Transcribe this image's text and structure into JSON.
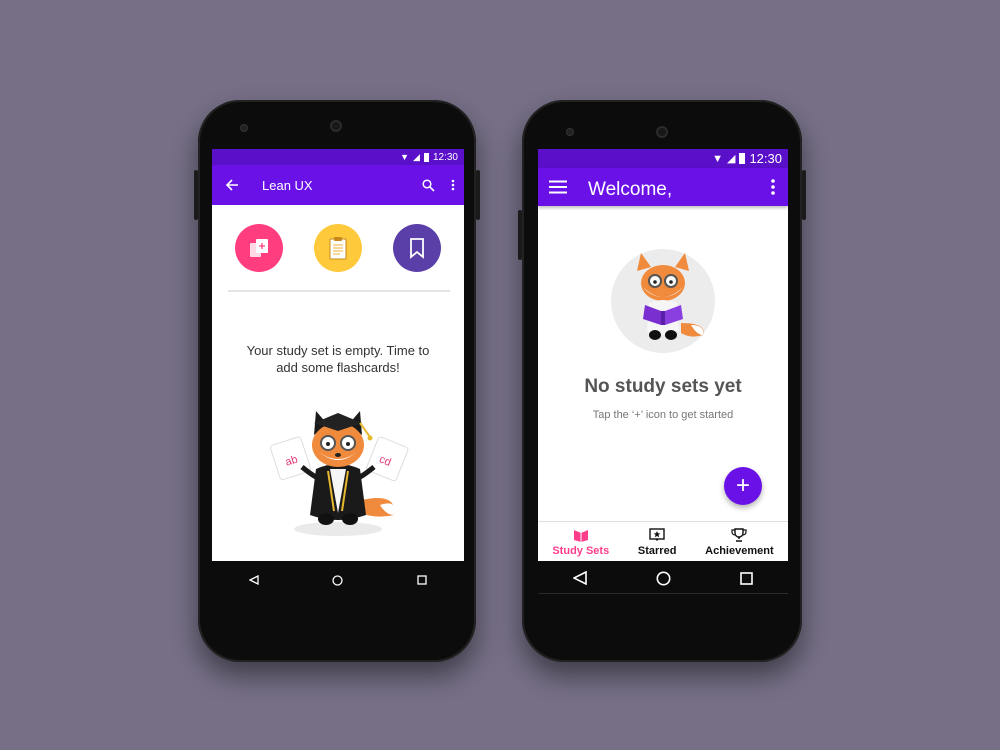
{
  "left_phone": {
    "status": {
      "time": "12:30"
    },
    "appbar": {
      "title": "Lean UX"
    },
    "actions": [
      {
        "name": "add-card",
        "color": "#ff3d7f"
      },
      {
        "name": "clipboard",
        "color": "#ffc93c"
      },
      {
        "name": "bookmark",
        "color": "#5a3fa8"
      }
    ],
    "empty_message": "Your study set is empty. Time to add some flashcards!",
    "cards": {
      "left": "ab",
      "right": "cd"
    },
    "accent": "#6a11e8"
  },
  "right_phone": {
    "status": {
      "time": "12:30"
    },
    "appbar": {
      "title": "Welcome,"
    },
    "empty_title": "No study sets yet",
    "empty_subtitle": "Tap the ‘+’ icon to get started",
    "fab_label": "+",
    "tabs": [
      {
        "label": "Study Sets",
        "icon": "book-icon",
        "active": true
      },
      {
        "label": "Starred",
        "icon": "star-icon",
        "active": false
      },
      {
        "label": "Achievement",
        "icon": "trophy-icon",
        "active": false
      }
    ],
    "accent": "#6a11e8",
    "active_tab_color": "#ff3d8b"
  }
}
